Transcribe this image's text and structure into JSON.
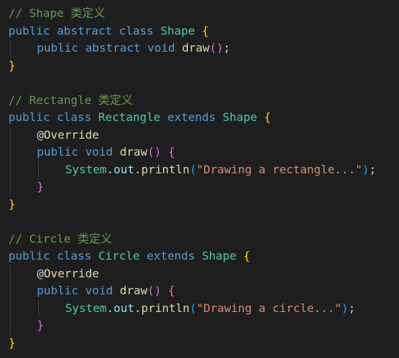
{
  "colors": {
    "background": "#1e1e1e",
    "keyword": "#569cd6",
    "type": "#4ec9b0",
    "function": "#dcdcaa",
    "string": "#ce9178",
    "comment": "#6a9955",
    "variable": "#9cdcfe",
    "plain": "#d4d4d4",
    "bracket_level1": "#ffd700",
    "bracket_level2": "#da70d6",
    "bracket_level3": "#179fff",
    "indent_guide": "#404040"
  },
  "code": {
    "shape_comment": "// Shape 类定义",
    "shape_decl": {
      "public": "public",
      "abstract": "abstract",
      "class": "class",
      "name": "Shape",
      "open": "{"
    },
    "shape_draw": {
      "public": "public",
      "abstract": "abstract",
      "void": "void",
      "name": "draw",
      "parens": "()",
      "semi": ";"
    },
    "shape_close": "}",
    "rect_comment": "// Rectangle 类定义",
    "rect_decl": {
      "public": "public",
      "class": "class",
      "name": "Rectangle",
      "extends": "extends",
      "parent": "Shape",
      "open": "{"
    },
    "rect_override": {
      "at": "@",
      "name": "Override"
    },
    "rect_draw": {
      "public": "public",
      "void": "void",
      "name": "draw",
      "parens": "()",
      "open": "{"
    },
    "rect_print": {
      "obj": "System",
      "dot1": ".",
      "field": "out",
      "dot2": ".",
      "method": "println",
      "lparen": "(",
      "str": "\"Drawing a rectangle...\"",
      "rparen": ")",
      "semi": ";"
    },
    "rect_method_close": "}",
    "rect_close": "}",
    "circle_comment": "// Circle 类定义",
    "circle_decl": {
      "public": "public",
      "class": "class",
      "name": "Circle",
      "extends": "extends",
      "parent": "Shape",
      "open": "{"
    },
    "circle_override": {
      "at": "@",
      "name": "Override"
    },
    "circle_draw": {
      "public": "public",
      "void": "void",
      "name": "draw",
      "parens": "()",
      "open": "{"
    },
    "circle_print": {
      "obj": "System",
      "dot1": ".",
      "field": "out",
      "dot2": ".",
      "method": "println",
      "lparen": "(",
      "str": "\"Drawing a circle...\"",
      "rparen": ")",
      "semi": ";"
    },
    "circle_method_close": "}",
    "circle_close": "}"
  }
}
